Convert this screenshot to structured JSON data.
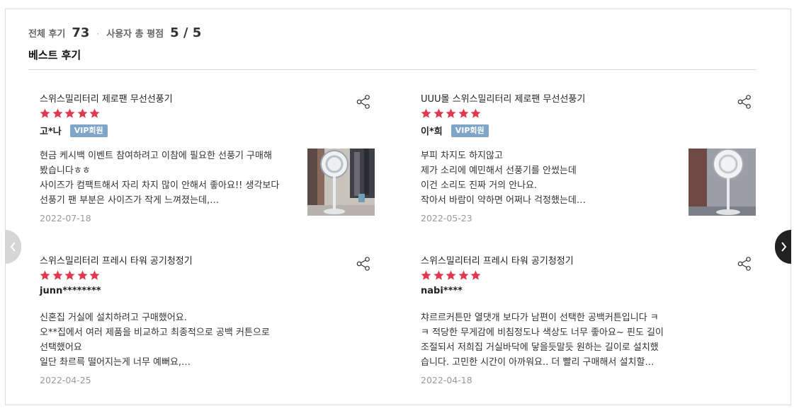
{
  "summary": {
    "total_label": "전체 후기",
    "total_count": "73",
    "separator": "·",
    "rating_label": "사용자 총 평점",
    "rating_value": "5 / 5"
  },
  "best_title": "베스트 후기",
  "nav": {
    "prev_icon": "chevron-left-icon",
    "next_icon": "chevron-right-icon"
  },
  "colors": {
    "star": "#e0394f",
    "vip_badge": "#7fa5c8",
    "next_button": "#222222",
    "prev_button": "#d6d6d6"
  },
  "reviews": [
    {
      "product": "스위스밀리터리 제로팬 무선선풍기",
      "rating": 5,
      "user": "고*나",
      "badge": "VIP회원",
      "lines": [
        "현금 케시백 이벤트 참여하려고 이참에 필요한 선풍기 구매해",
        "봤습니다ㅎㅎ",
        "사이즈가 컴팩트해서 자리 차지 많이 안해서 좋아요!! 생각보다",
        "선풍기 팬 부분은 사이즈가 작게 느껴졌는데,…"
      ],
      "date": "2022-07-18",
      "has_photo": true
    },
    {
      "product": "UUU몰 스위스밀리터리 제로팬 무선선풍기",
      "rating": 5,
      "user": "이*희",
      "badge": "VIP회원",
      "lines": [
        "부피 차지도 하지않고",
        "제가 소리에 예민해서 선풍기를 안썼는데",
        "이건 소리도 진짜 거의 안나요.",
        "작아서 바람이 약하면 어쩌나 걱정했는데…"
      ],
      "date": "2022-05-23",
      "has_photo": true
    },
    {
      "product": "스위스밀리터리 프레시 타워 공기청정기",
      "rating": 5,
      "user": "junn********",
      "badge": "",
      "lines": [
        "신혼집 거실에 설치하려고 구매했어요.",
        "오**집에서 여러 제품을 비교하고 최종적으로 공백 커튼으로",
        "선택했어요",
        "일단 촤르륵 떨어지는게 너무 예뻐요,…"
      ],
      "date": "2022-04-25",
      "has_photo": false
    },
    {
      "product": "스위스밀리터리 프레시 타워 공기청정기",
      "rating": 5,
      "user": "nabi****",
      "badge": "",
      "lines": [
        "챠르르커튼만 열댓개 보다가 남편이 선택한 공백커튼입니다 ㅋ",
        "ㅋ 적당한 무게감에 비침정도나 색상도 너무 좋아요~ 핀도 길이",
        "조절되서 저희집 거실바닥에 닿을듯말듯 원하는 길이로 설치했",
        "습니다. 고민한 시간이 아까워요.. 더 빨리 구매해서 설치할…"
      ],
      "date": "2022-04-18",
      "has_photo": false
    }
  ]
}
